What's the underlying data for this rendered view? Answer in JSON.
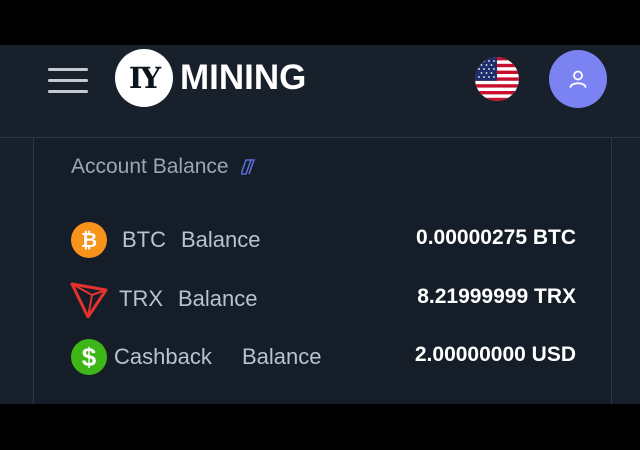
{
  "header": {
    "logo_mark": "IY",
    "logo_text": "MINING",
    "flag_icon": "us-flag-icon",
    "user_icon": "user-icon"
  },
  "card": {
    "title": "Account Balance",
    "rows": [
      {
        "currency": "BTC",
        "label_word": "Balance",
        "amount": "0.00000275 BTC",
        "icon": "bitcoin-icon",
        "color": "#f7931a"
      },
      {
        "currency": "TRX",
        "label_word": "Balance",
        "amount": "8.21999999 TRX",
        "icon": "tron-icon",
        "color": "#e5322d"
      },
      {
        "currency": "Cashback",
        "label_word": "Balance",
        "amount": "2.00000000 USD",
        "icon": "dollar-icon",
        "color": "#3fb618"
      }
    ]
  },
  "colors": {
    "background": "#17202b",
    "avatar": "#7b83f2",
    "title_text": "#9aa6b8"
  }
}
